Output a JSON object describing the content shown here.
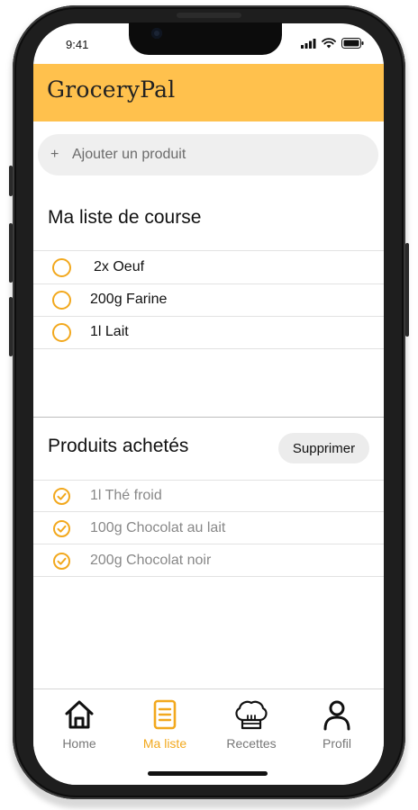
{
  "status": {
    "time": "9:41"
  },
  "app": {
    "title": "GroceryPal"
  },
  "add_bar": {
    "plus": "+",
    "label": "Ajouter un produit"
  },
  "shopping_list": {
    "title": "Ma liste de course",
    "items": [
      {
        "label": "2x Oeuf"
      },
      {
        "label": "200g Farine"
      },
      {
        "label": "1l Lait"
      }
    ]
  },
  "bought": {
    "title": "Produits achetés",
    "delete_label": "Supprimer",
    "items": [
      {
        "label": "1l Thé froid"
      },
      {
        "label": "100g Chocolat au lait"
      },
      {
        "label": "200g Chocolat noir"
      }
    ]
  },
  "nav": {
    "items": [
      {
        "label": "Home",
        "icon": "home-icon"
      },
      {
        "label": "Ma liste",
        "icon": "list-icon",
        "active": true
      },
      {
        "label": "Recettes",
        "icon": "chef-hat-icon"
      },
      {
        "label": "Profil",
        "icon": "user-icon"
      }
    ]
  },
  "colors": {
    "accent": "#F2A81D",
    "header": "#FFC14D"
  }
}
